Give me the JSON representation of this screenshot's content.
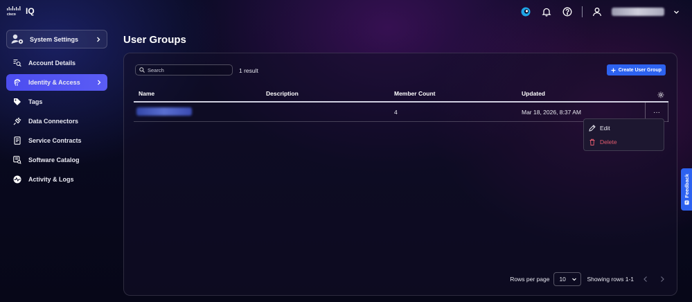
{
  "brand": {
    "logo_text": "IQ"
  },
  "header": {
    "user_name": ""
  },
  "sidebar": {
    "settings_label": "System Settings",
    "items": [
      {
        "label": "Account Details"
      },
      {
        "label": "Identity & Access"
      },
      {
        "label": "Tags"
      },
      {
        "label": "Data Connectors"
      },
      {
        "label": "Service Contracts"
      },
      {
        "label": "Software Catalog"
      },
      {
        "label": "Activity & Logs"
      }
    ]
  },
  "main": {
    "title": "User Groups",
    "search_placeholder": "Search",
    "result_count": "1 result",
    "create_label": "Create User Group",
    "columns": [
      "Name",
      "Description",
      "Member Count",
      "Updated"
    ],
    "rows": [
      {
        "name": "",
        "description": "",
        "member_count": "4",
        "updated": "Mar 18, 2026, 8:37 AM"
      }
    ],
    "row_menu": {
      "edit": "Edit",
      "delete": "Delete"
    },
    "pagination": {
      "rows_per_page_label": "Rows per page",
      "rows_per_page_value": "10",
      "showing": "Showing rows 1-1"
    }
  },
  "feedback_label": "Feedback",
  "colors": {
    "accent": "#2d62f0",
    "active_nav": "#4c4df0",
    "danger": "#e25b6e"
  }
}
